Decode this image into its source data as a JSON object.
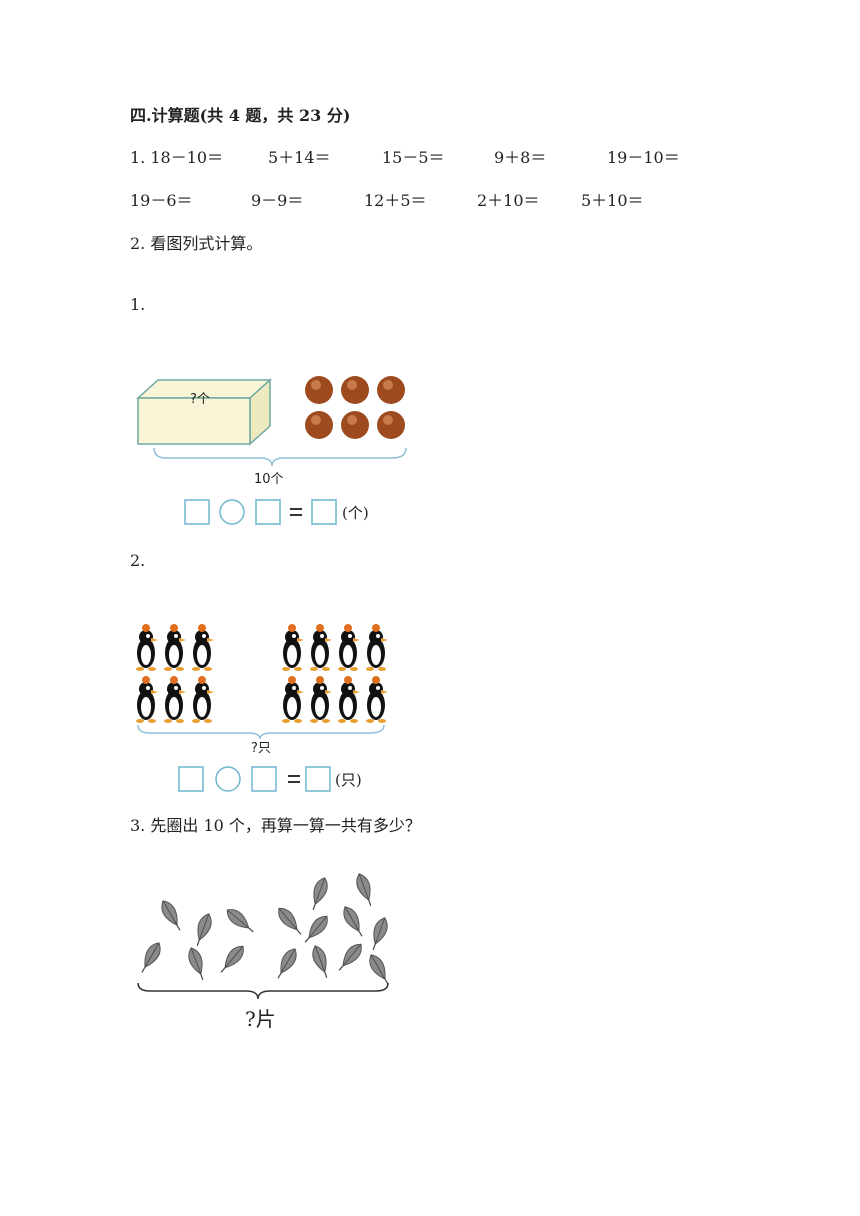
{
  "section_title": "四.计算题(共 4 题，共 23 分)",
  "q1": {
    "row1": [
      "1. 18－10＝",
      "5＋14＝",
      "15－5＝",
      "9＋8＝",
      "19－10＝"
    ],
    "row2": [
      "19－6＝",
      "9－9＝",
      "12＋5＝",
      "2＋10＝",
      "5＋10＝"
    ]
  },
  "q2": {
    "instruction": "2. 看图列式计算。",
    "sub1": {
      "label": "1.",
      "box_label": "?个",
      "total_label": "10个",
      "unit": "(个)"
    },
    "sub2": {
      "label": "2.",
      "total_label": "?只",
      "unit": "(只)"
    }
  },
  "q3": {
    "instruction": "3. 先圈出 10 个，再算一算一共有多少？",
    "total_label": "?片"
  },
  "colors": {
    "box_fill": "#f8f6d6",
    "box_stroke": "#6fa8a0",
    "brace": "#8fc0d8",
    "answer_box": "#6fb6cf",
    "chestnut": "#9c4a1e",
    "leaf": "#777777"
  }
}
